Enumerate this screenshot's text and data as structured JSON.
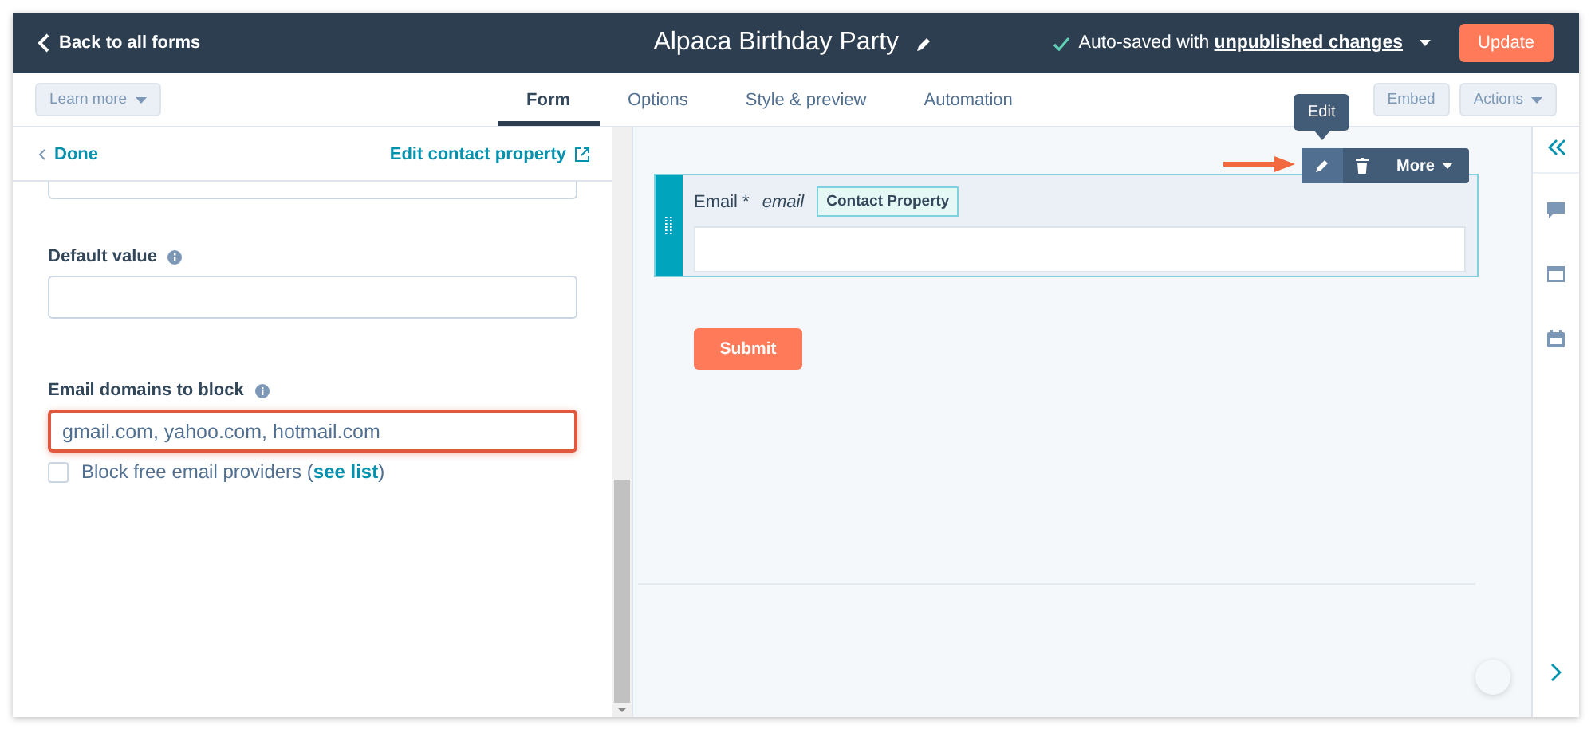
{
  "header": {
    "back_link": "Back to all forms",
    "form_title": "Alpaca Birthday Party",
    "save_status": "Auto-saved with **unpublished changes**",
    "update_button": "Update"
  },
  "subnav": {
    "learn_more": "Learn more",
    "tabs": [
      {
        "label": "Form",
        "selected": true
      },
      {
        "label": "Options",
        "selected": false
      },
      {
        "label": "Style & preview",
        "selected": false
      },
      {
        "label": "Automation",
        "selected": false
      }
    ],
    "embed_button": "Embed",
    "actions_button": "Actions"
  },
  "panel": {
    "done_link": "Done",
    "edit_property_link": "Edit contact property",
    "fields": [
      {
        "label": "Default value",
        "highlighted": false
      },
      {
        "label": "Email domains to block",
        "value": "gmail.com, yahoo.com, hotmail.com",
        "highlighted": true
      }
    ],
    "checkbox": {
      "label": "Block free email providers (",
      "link": "see list",
      "suffix": ")",
      "checked": false
    }
  },
  "canvas": {
    "field": {
      "label": "Email *",
      "internal_name": "email",
      "badge": "Contact Property",
      "selected": true
    },
    "tooltip": "Edit",
    "more_button": "More",
    "submit_button": "Submit"
  }
}
